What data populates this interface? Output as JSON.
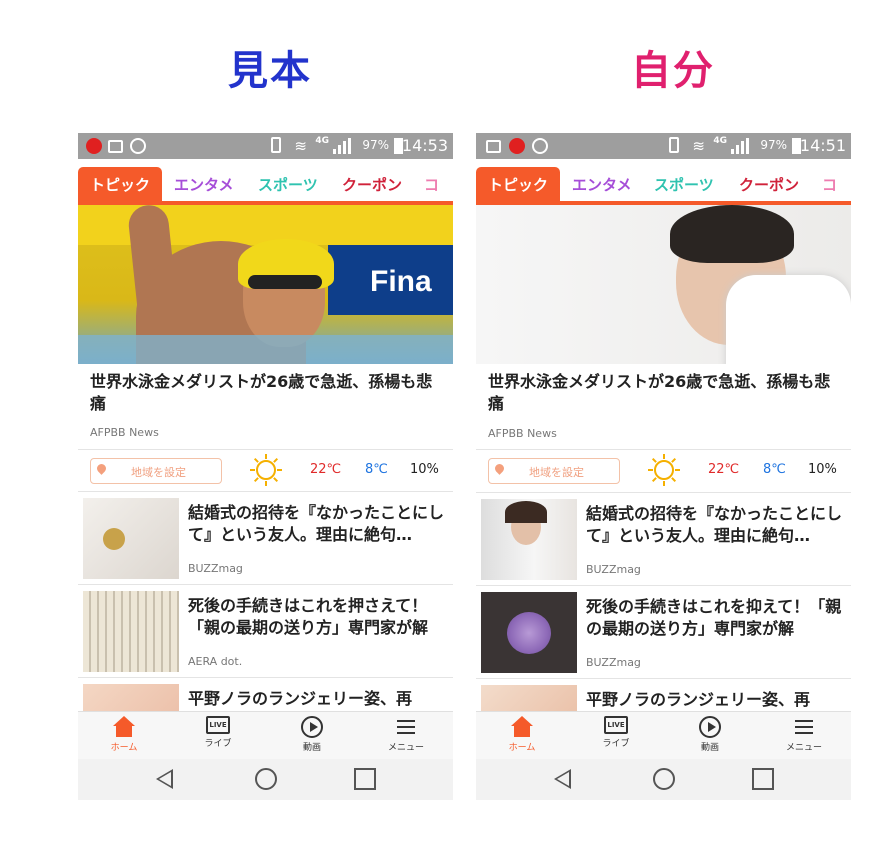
{
  "headings": {
    "left": "見本",
    "right": "自分"
  },
  "phones": {
    "left": {
      "status": {
        "battery": "97%",
        "time": "14:53",
        "network": "4G"
      },
      "tabs": [
        {
          "label": "トピック",
          "color": "#ffffff"
        },
        {
          "label": "エンタメ",
          "color": "#a64ed8"
        },
        {
          "label": "スポーツ",
          "color": "#2fc3b0"
        },
        {
          "label": "クーポン",
          "color": "#d0223a"
        },
        {
          "label": "コラ",
          "color": "#ee7cb0"
        }
      ],
      "hero": {
        "title": "世界水泳金メダリストが26歳で急逝、孫楊も悲痛",
        "source": "AFPBB News"
      },
      "weather": {
        "region_button": "地域を設定",
        "high": "22℃",
        "low": "8℃",
        "rain": "10%"
      },
      "items": [
        {
          "title": "結婚式の招待を『なかったことにして』という友人。理由に絶句…",
          "source": "BUZZmag"
        },
        {
          "title": "死後の手続きはこれを押さえて！「親の最期の送り方」専門家が解",
          "source": "AERA dot."
        },
        {
          "title": "平野ノラのランジェリー姿、再",
          "source": ""
        }
      ],
      "nav": [
        {
          "label": "ホーム",
          "icon": "home-icon"
        },
        {
          "label": "ライブ",
          "icon": "live-icon"
        },
        {
          "label": "動画",
          "icon": "play-icon"
        },
        {
          "label": "メニュー",
          "icon": "menu-icon"
        }
      ]
    },
    "right": {
      "status": {
        "battery": "97%",
        "time": "14:51",
        "network": "4G"
      },
      "tabs": [
        {
          "label": "トピック",
          "color": "#ffffff"
        },
        {
          "label": "エンタメ",
          "color": "#a64ed8"
        },
        {
          "label": "スポーツ",
          "color": "#2fc3b0"
        },
        {
          "label": "クーポン",
          "color": "#d0223a"
        },
        {
          "label": "コラ",
          "color": "#ee7cb0"
        }
      ],
      "hero": {
        "title": "世界水泳金メダリストが26歳で急逝、孫楊も悲痛",
        "source": "AFPBB News"
      },
      "weather": {
        "region_button": "地域を設定",
        "high": "22℃",
        "low": "8℃",
        "rain": "10%"
      },
      "items": [
        {
          "title": "結婚式の招待を『なかったことにして』という友人。理由に絶句…",
          "source": "BUZZmag"
        },
        {
          "title": "死後の手続きはこれを抑えて！「親の最期の送り方」専門家が解",
          "source": "BUZZmag"
        },
        {
          "title": "平野ノラのランジェリー姿、再",
          "source": ""
        }
      ],
      "nav": [
        {
          "label": "ホーム",
          "icon": "home-icon"
        },
        {
          "label": "ライブ",
          "icon": "live-icon"
        },
        {
          "label": "動画",
          "icon": "play-icon"
        },
        {
          "label": "メニュー",
          "icon": "menu-icon"
        }
      ]
    }
  },
  "colors": {
    "accent": "#f55a2a",
    "status_bar": "#9e9e9e",
    "high_temp": "#e02a2a",
    "low_temp": "#1f74e0"
  }
}
